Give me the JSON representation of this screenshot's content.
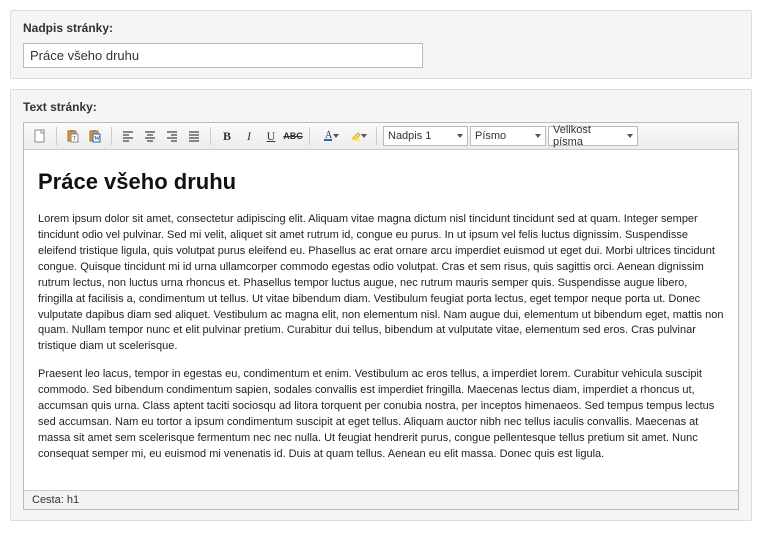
{
  "title_field": {
    "label": "Nadpis stránky:",
    "value": "Práce všeho druhu"
  },
  "text_field": {
    "label": "Text stránky:"
  },
  "toolbar": {
    "format_select": "Nadpis 1",
    "font_select": "Písmo",
    "size_select": "Velikost písma"
  },
  "content": {
    "heading": "Práce všeho druhu",
    "p1": "Lorem ipsum dolor sit amet, consectetur adipiscing elit. Aliquam vitae magna dictum nisl tincidunt tincidunt sed at quam. Integer semper tincidunt odio vel pulvinar. Sed mi velit, aliquet sit amet rutrum id, congue eu purus. In ut ipsum vel felis luctus dignissim. Suspendisse eleifend tristique ligula, quis volutpat purus eleifend eu. Phasellus ac erat ornare arcu imperdiet euismod ut eget dui. Morbi ultrices tincidunt congue. Quisque tincidunt mi id urna ullamcorper commodo egestas odio volutpat. Cras et sem risus, quis sagittis orci. Aenean dignissim rutrum lectus, non luctus urna rhoncus et. Phasellus tempor luctus augue, nec rutrum mauris semper quis. Suspendisse augue libero, fringilla at facilisis a, condimentum ut tellus. Ut vitae bibendum diam. Vestibulum feugiat porta lectus, eget tempor neque porta ut. Donec vulputate dapibus diam sed aliquet. Vestibulum ac magna elit, non elementum nisl. Nam augue dui, elementum ut bibendum eget, mattis non quam. Nullam tempor nunc et elit pulvinar pretium. Curabitur dui tellus, bibendum at vulputate vitae, elementum sed eros. Cras pulvinar tristique diam ut scelerisque.",
    "p2": "Praesent leo lacus, tempor in egestas eu, condimentum et enim. Vestibulum ac eros tellus, a imperdiet lorem. Curabitur vehicula suscipit commodo. Sed bibendum condimentum sapien, sodales convallis est imperdiet fringilla. Maecenas lectus diam, imperdiet a rhoncus ut, accumsan quis urna. Class aptent taciti sociosqu ad litora torquent per conubia nostra, per inceptos himenaeos. Sed tempus tempus lectus sed accumsan. Nam eu tortor a ipsum condimentum suscipit at eget tellus. Aliquam auctor nibh nec tellus iaculis convallis. Maecenas at massa sit amet sem scelerisque fermentum nec nec nulla. Ut feugiat hendrerit purus, congue pellentesque tellus pretium sit amet. Nunc consequat semper mi, eu euismod mi venenatis id. Duis at quam tellus. Aenean eu elit massa. Donec quis est ligula."
  },
  "path": {
    "label": "Cesta:",
    "value": "h1"
  }
}
